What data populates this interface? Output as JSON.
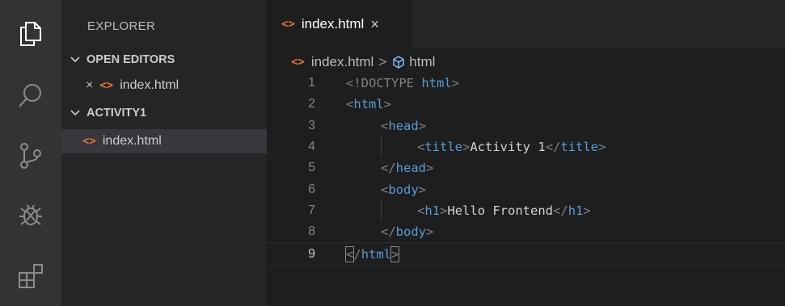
{
  "activity_bar": {
    "items": [
      {
        "name": "explorer-icon"
      },
      {
        "name": "search-icon"
      },
      {
        "name": "source-control-icon"
      },
      {
        "name": "debug-icon"
      },
      {
        "name": "extensions-icon"
      }
    ]
  },
  "sidebar": {
    "title": "EXPLORER",
    "open_editors": {
      "label": "OPEN EDITORS",
      "close_symbol": "×",
      "files": [
        "index.html"
      ]
    },
    "project": {
      "label": "ACTIVITY1",
      "files": [
        "index.html"
      ]
    }
  },
  "editor": {
    "tab": {
      "label": "index.html",
      "close_symbol": "×"
    },
    "breadcrumb": {
      "file": "index.html",
      "separator": ">",
      "symbol": "html"
    },
    "lines": [
      {
        "n": "1",
        "tokens": [
          {
            "t": "<!DOCTYPE ",
            "c": "br"
          },
          {
            "t": "html",
            "c": "tag"
          },
          {
            "t": ">",
            "c": "br"
          }
        ]
      },
      {
        "n": "2",
        "tokens": [
          {
            "t": "<",
            "c": "br"
          },
          {
            "t": "html",
            "c": "tag"
          },
          {
            "t": ">",
            "c": "br"
          }
        ]
      },
      {
        "n": "3",
        "tokens": [
          {
            "t": "<",
            "c": "br"
          },
          {
            "t": "head",
            "c": "tag"
          },
          {
            "t": ">",
            "c": "br"
          }
        ]
      },
      {
        "n": "4",
        "tokens": [
          {
            "t": "<",
            "c": "br"
          },
          {
            "t": "title",
            "c": "tag"
          },
          {
            "t": ">",
            "c": "br"
          },
          {
            "t": "Activity 1",
            "c": "text"
          },
          {
            "t": "</",
            "c": "br"
          },
          {
            "t": "title",
            "c": "tag"
          },
          {
            "t": ">",
            "c": "br"
          }
        ]
      },
      {
        "n": "5",
        "tokens": [
          {
            "t": "</",
            "c": "br"
          },
          {
            "t": "head",
            "c": "tag"
          },
          {
            "t": ">",
            "c": "br"
          }
        ]
      },
      {
        "n": "6",
        "tokens": [
          {
            "t": "<",
            "c": "br"
          },
          {
            "t": "body",
            "c": "tag"
          },
          {
            "t": ">",
            "c": "br"
          }
        ]
      },
      {
        "n": "7",
        "tokens": [
          {
            "t": "<",
            "c": "br"
          },
          {
            "t": "h1",
            "c": "tag"
          },
          {
            "t": ">",
            "c": "br"
          },
          {
            "t": "Hello Frontend",
            "c": "text"
          },
          {
            "t": "</",
            "c": "br"
          },
          {
            "t": "h1",
            "c": "tag"
          },
          {
            "t": ">",
            "c": "br"
          }
        ]
      },
      {
        "n": "8",
        "tokens": [
          {
            "t": "</",
            "c": "br"
          },
          {
            "t": "body",
            "c": "tag"
          },
          {
            "t": ">",
            "c": "br"
          }
        ]
      },
      {
        "n": "9",
        "tokens": [
          {
            "t": "<",
            "c": "br",
            "m": true
          },
          {
            "t": "/",
            "c": "br"
          },
          {
            "t": "html",
            "c": "tag"
          },
          {
            "t": ">",
            "c": "br",
            "m": true
          }
        ]
      }
    ],
    "current_line": "9"
  },
  "colors": {
    "activity_bg": "#333333",
    "sidebar_bg": "#252526",
    "editor_bg": "#1e1e1e",
    "html_icon": "#e37933",
    "tag": "#569cd6",
    "bracket": "#808080",
    "text": "#d4d4d4"
  }
}
